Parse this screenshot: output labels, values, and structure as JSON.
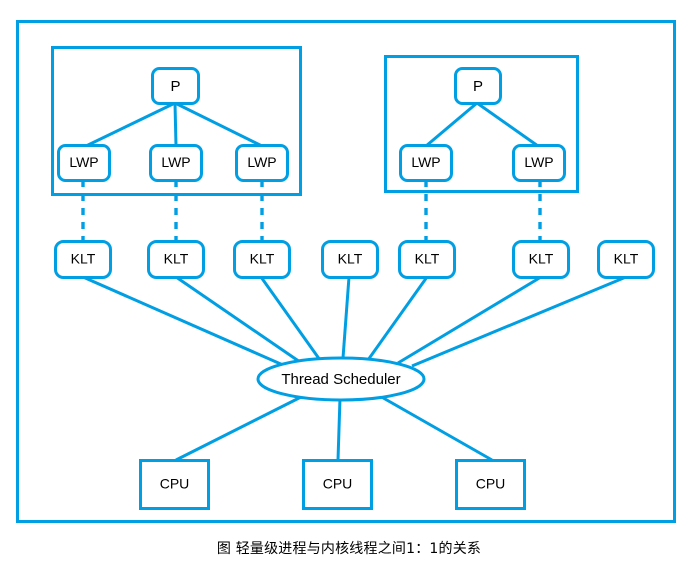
{
  "diagram": {
    "caption": "图 轻量级进程与内核线程之间1：1的关系",
    "accent_color": "#009fe3",
    "background_color": "#ffffff",
    "text_color": "#000000",
    "outer_frame": {
      "name": "diagram-border"
    },
    "process_groups": [
      {
        "id": "process-group-left",
        "process": {
          "label": "P"
        },
        "lwps": [
          {
            "label": "LWP"
          },
          {
            "label": "LWP"
          },
          {
            "label": "LWP"
          }
        ]
      },
      {
        "id": "process-group-right",
        "process": {
          "label": "P"
        },
        "lwps": [
          {
            "label": "LWP"
          },
          {
            "label": "LWP"
          }
        ]
      }
    ],
    "kernel_threads": [
      {
        "label": "KLT",
        "linked_to_lwp": true
      },
      {
        "label": "KLT",
        "linked_to_lwp": true
      },
      {
        "label": "KLT",
        "linked_to_lwp": true
      },
      {
        "label": "KLT",
        "linked_to_lwp": false
      },
      {
        "label": "KLT",
        "linked_to_lwp": true
      },
      {
        "label": "KLT",
        "linked_to_lwp": true
      },
      {
        "label": "KLT",
        "linked_to_lwp": false
      }
    ],
    "scheduler": {
      "label": "Thread Scheduler"
    },
    "cpus": [
      {
        "label": "CPU"
      },
      {
        "label": "CPU"
      },
      {
        "label": "CPU"
      }
    ]
  }
}
